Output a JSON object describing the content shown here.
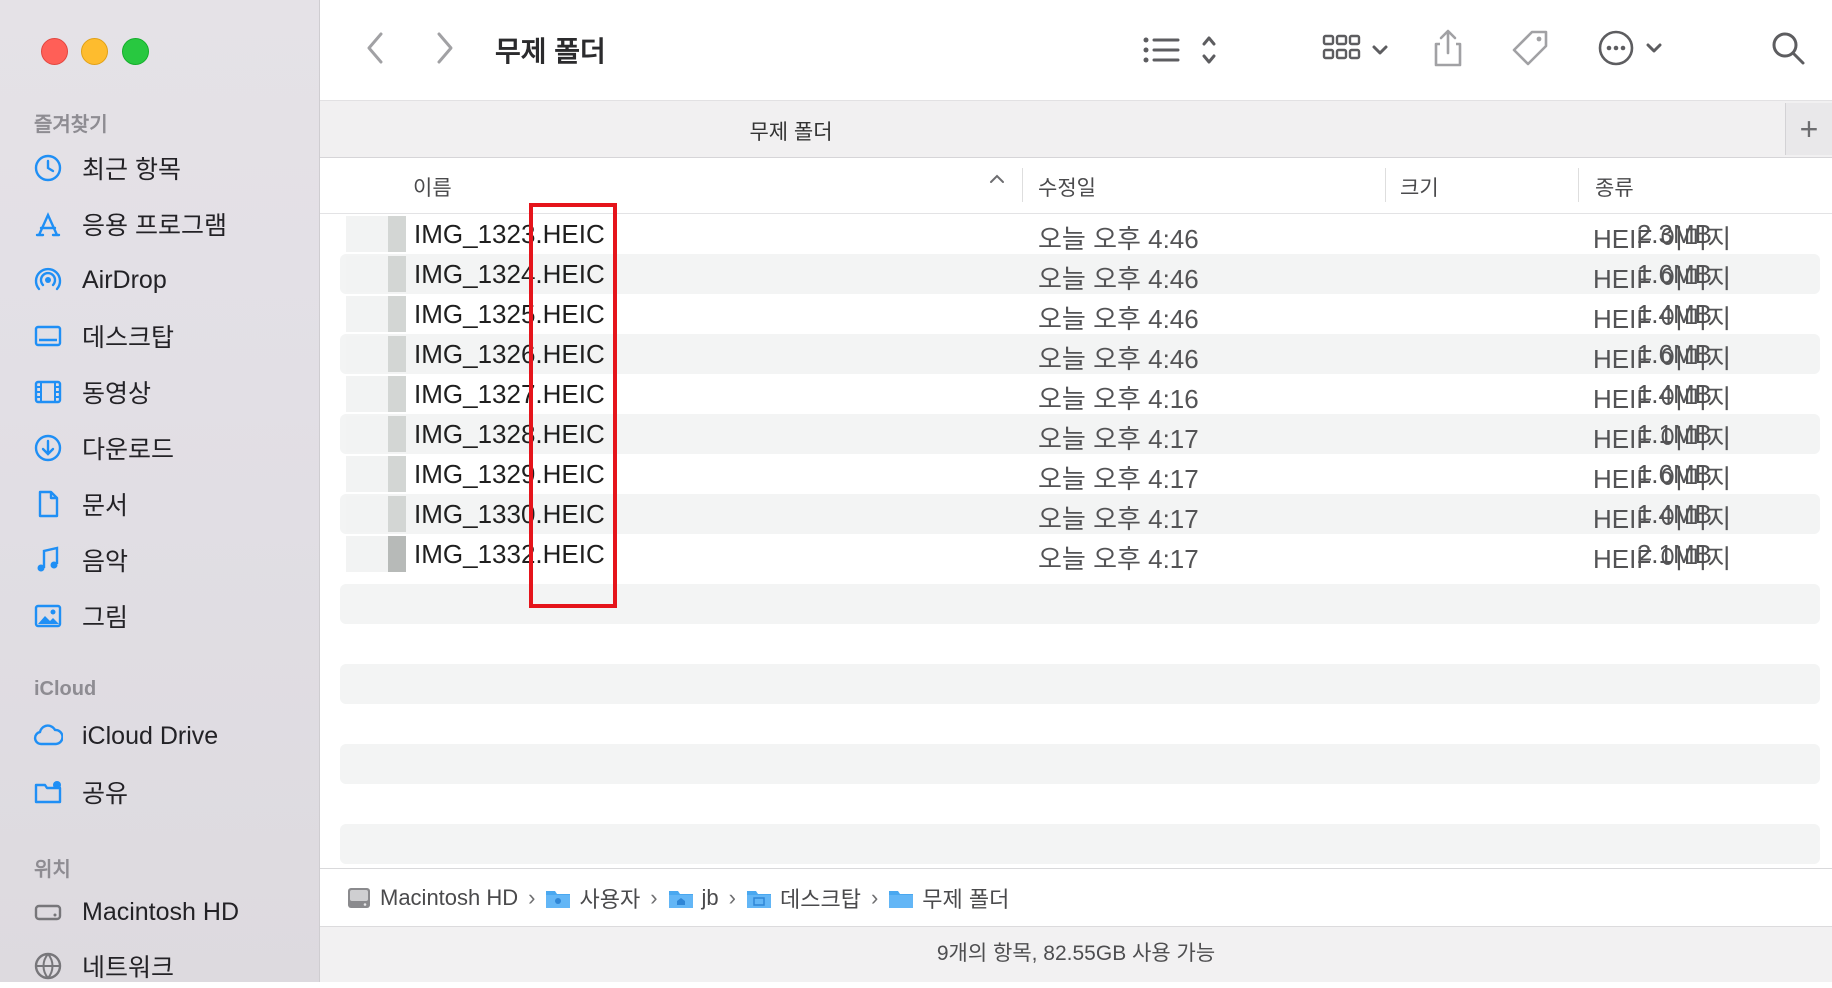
{
  "window": {
    "title": "무제 폴더"
  },
  "sidebar": {
    "sections": [
      {
        "label": "즐겨찾기"
      },
      {
        "label": "iCloud"
      },
      {
        "label": "위치"
      }
    ],
    "favorites": [
      {
        "label": "최근 항목",
        "icon": "clock-icon"
      },
      {
        "label": "응용 프로그램",
        "icon": "applications-icon"
      },
      {
        "label": "AirDrop",
        "icon": "airdrop-icon"
      },
      {
        "label": "데스크탑",
        "icon": "desktop-icon"
      },
      {
        "label": "동영상",
        "icon": "film-icon"
      },
      {
        "label": "다운로드",
        "icon": "download-icon"
      },
      {
        "label": "문서",
        "icon": "document-icon"
      },
      {
        "label": "음악",
        "icon": "music-icon"
      },
      {
        "label": "그림",
        "icon": "photo-icon"
      }
    ],
    "icloud": [
      {
        "label": "iCloud Drive",
        "icon": "cloud-icon"
      },
      {
        "label": "공유",
        "icon": "shared-folder-icon"
      }
    ],
    "locations": [
      {
        "label": "Macintosh HD",
        "icon": "disk-icon"
      },
      {
        "label": "네트워크",
        "icon": "network-icon"
      }
    ]
  },
  "toolbar": {
    "title": "무제 폴더"
  },
  "tab": {
    "label": "무제 폴더",
    "add": "+"
  },
  "columns": {
    "name": "이름",
    "modified": "수정일",
    "size": "크기",
    "kind": "종류"
  },
  "files": [
    {
      "name": "IMG_1323.HEIC",
      "date": "오늘 오후 4:46",
      "size": "2.3MB",
      "kind": "HEIF 이미지"
    },
    {
      "name": "IMG_1324.HEIC",
      "date": "오늘 오후 4:46",
      "size": "1.6MB",
      "kind": "HEIF 이미지"
    },
    {
      "name": "IMG_1325.HEIC",
      "date": "오늘 오후 4:46",
      "size": "1.4MB",
      "kind": "HEIF 이미지"
    },
    {
      "name": "IMG_1326.HEIC",
      "date": "오늘 오후 4:46",
      "size": "1.6MB",
      "kind": "HEIF 이미지"
    },
    {
      "name": "IMG_1327.HEIC",
      "date": "오늘 오후 4:16",
      "size": "1.4MB",
      "kind": "HEIF 이미지"
    },
    {
      "name": "IMG_1328.HEIC",
      "date": "오늘 오후 4:17",
      "size": "1.1MB",
      "kind": "HEIF 이미지"
    },
    {
      "name": "IMG_1329.HEIC",
      "date": "오늘 오후 4:17",
      "size": "1.6MB",
      "kind": "HEIF 이미지"
    },
    {
      "name": "IMG_1330.HEIC",
      "date": "오늘 오후 4:17",
      "size": "1.4MB",
      "kind": "HEIF 이미지"
    },
    {
      "name": "IMG_1332.HEIC",
      "date": "오늘 오후 4:17",
      "size": "2.1MB",
      "kind": "HEIF 이미지"
    }
  ],
  "path": [
    "Macintosh HD",
    "사용자",
    "jb",
    "데스크탑",
    "무제 폴더"
  ],
  "status": "9개의 항목, 82.55GB 사용 가능",
  "colors": {
    "highlight": "#e5141b",
    "accent": "#1f8ff5"
  }
}
